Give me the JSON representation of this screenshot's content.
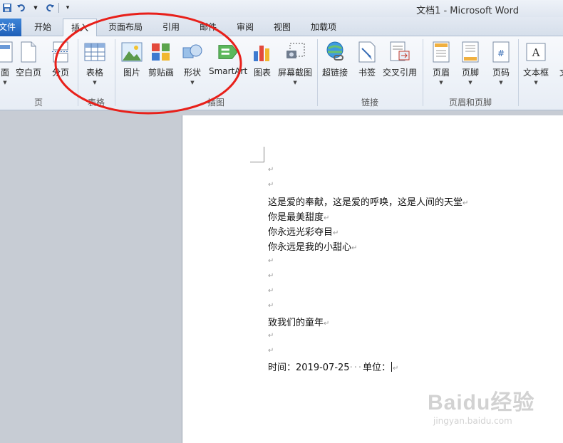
{
  "window": {
    "title": "文档1 - Microsoft Word"
  },
  "tabs": [
    {
      "label": "文件"
    },
    {
      "label": "开始"
    },
    {
      "label": "插入"
    },
    {
      "label": "页面布局"
    },
    {
      "label": "引用"
    },
    {
      "label": "邮件"
    },
    {
      "label": "审阅"
    },
    {
      "label": "视图"
    },
    {
      "label": "加载项"
    }
  ],
  "ribbon": {
    "buttons": {
      "cover": "面",
      "blank": "空白页",
      "pagebreak": "分页",
      "table": "表格",
      "picture": "图片",
      "clipart": "剪贴画",
      "shapes": "形状",
      "smartart": "SmartArt",
      "chart": "图表",
      "screenshot": "屏幕截图",
      "hyperlink": "超链接",
      "bookmark": "书签",
      "crossref": "交叉引用",
      "header": "页眉",
      "footer": "页脚",
      "pagenum": "页码",
      "textbox": "文本框",
      "more": "文"
    },
    "groups": {
      "pages": "页",
      "tables": "表格",
      "illustrations": "插图",
      "links": "链接",
      "headerfooter": "页眉和页脚"
    }
  },
  "document": {
    "lines": [
      "",
      "",
      "这是爱的奉献，这是爱的呼唤，这是人间的天堂",
      "你是最美甜度",
      "你永远光彩夺目",
      "你永远是我的小甜心",
      "",
      "",
      "",
      "",
      "致我们的童年",
      "",
      ""
    ],
    "last_line": {
      "time_label": "时间：",
      "date": "2019-07-25",
      "unit_label": "单位："
    },
    "paragraph_mark": "↵"
  },
  "watermark": {
    "brand": "Baidu经验",
    "url": "jingyan.baidu.com"
  },
  "colors": {
    "highlight": "#e8201a",
    "file_tab": "#2a6cc4"
  }
}
